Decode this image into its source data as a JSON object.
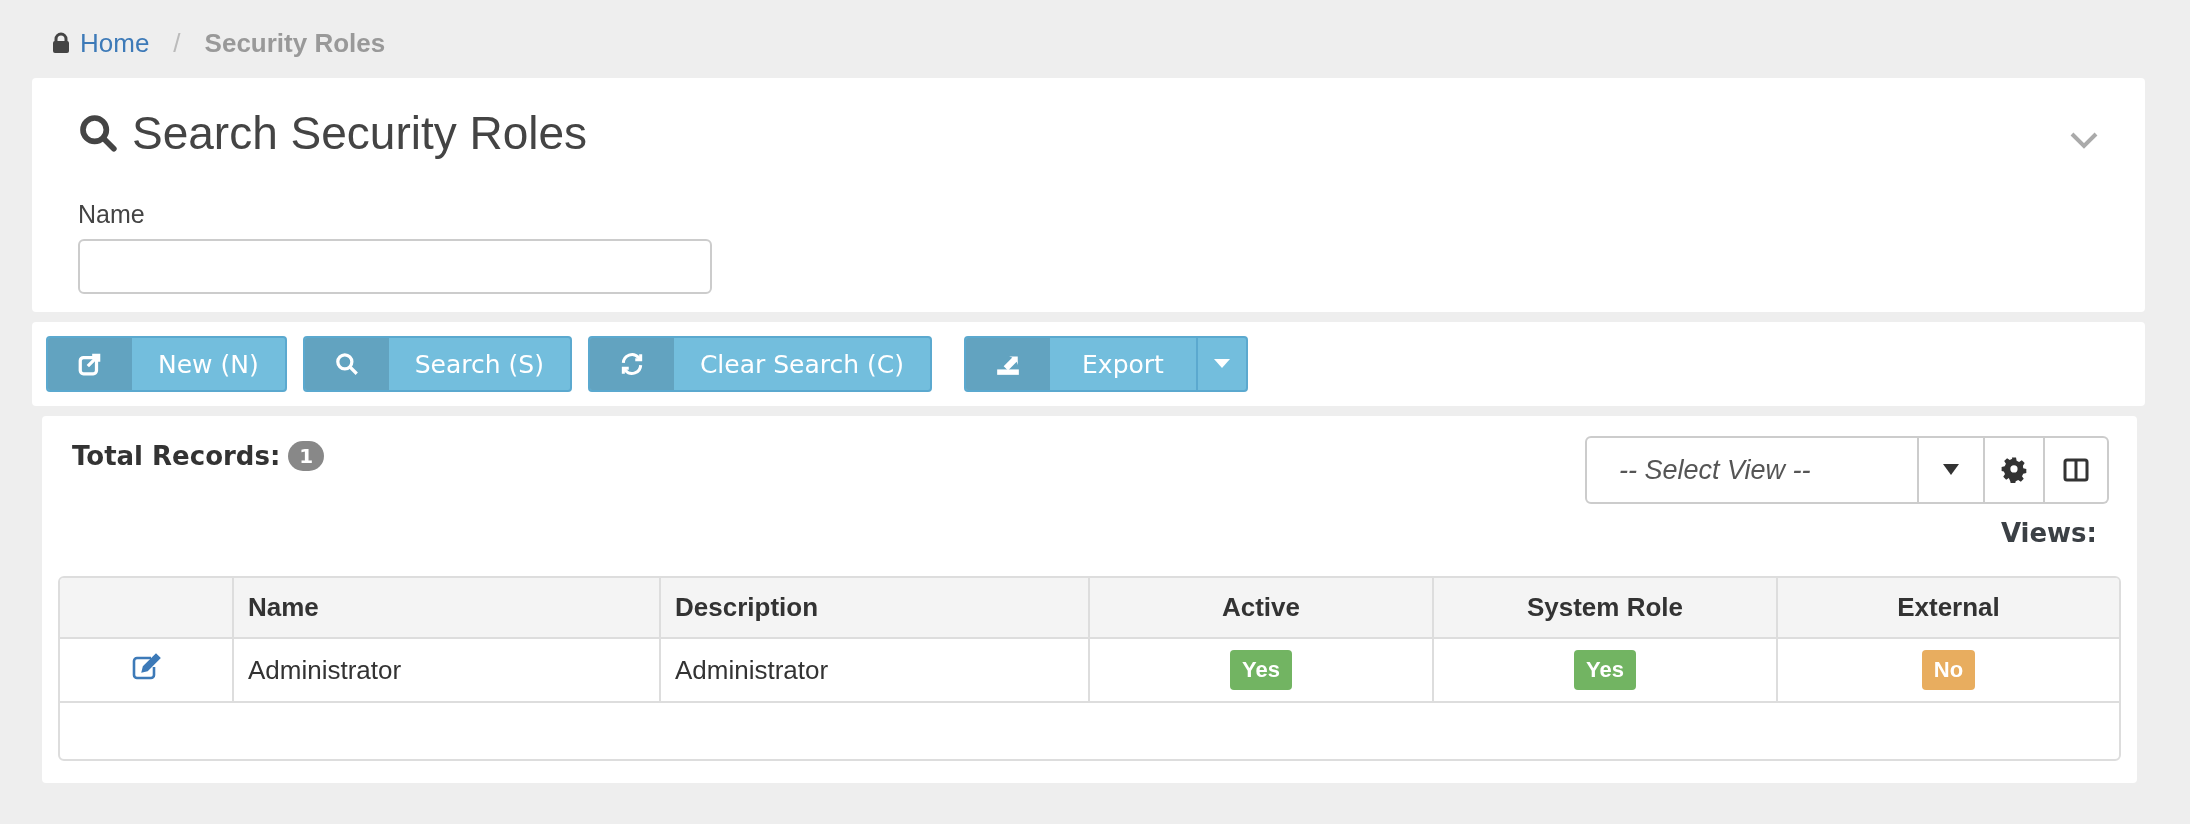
{
  "breadcrumb": {
    "home": "Home",
    "separator": "/",
    "current": "Security Roles"
  },
  "search_panel": {
    "title": "Search Security Roles",
    "expanded": true,
    "fields": [
      {
        "label": "Name"
      }
    ]
  },
  "toolbar": [
    {
      "kind": "button",
      "label": "New (N)"
    },
    {
      "kind": "button",
      "label": "Search (S)"
    },
    {
      "kind": "button",
      "label": "Clear Search (C)"
    },
    {
      "kind": "dropdown",
      "label": "Export"
    }
  ],
  "results": {
    "total_label": "Total Records:",
    "total": "1",
    "view_select": {
      "placeholder": "-- Select View --"
    },
    "views_label": "Views:"
  },
  "table": {
    "columns": [
      "",
      "Name",
      "Description",
      "Active",
      "System Role",
      "External"
    ],
    "rows": [
      {
        "cells": [
          {
            "kind": "edit"
          },
          {
            "kind": "text",
            "text": "Administrator"
          },
          {
            "kind": "text",
            "text": "Administrator"
          },
          {
            "kind": "badge",
            "text": "Yes",
            "color": "#72b462"
          },
          {
            "kind": "badge",
            "text": "Yes",
            "color": "#72b462"
          },
          {
            "kind": "badge",
            "text": "No",
            "color": "#e8ad5f"
          }
        ]
      }
    ]
  }
}
